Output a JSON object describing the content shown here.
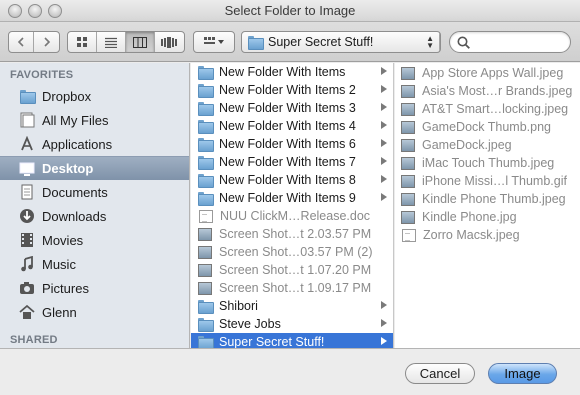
{
  "window": {
    "title": "Select Folder to Image"
  },
  "toolbar": {
    "path_popup": "Super Secret Stuff!",
    "search_placeholder": ""
  },
  "sidebar": {
    "favorites_header": "FAVORITES",
    "shared_header": "SHARED",
    "selected": "Desktop",
    "items": [
      {
        "label": "Dropbox",
        "icon": "folder-icon"
      },
      {
        "label": "All My Files",
        "icon": "all-files-icon"
      },
      {
        "label": "Applications",
        "icon": "applications-icon"
      },
      {
        "label": "Desktop",
        "icon": "desktop-icon"
      },
      {
        "label": "Documents",
        "icon": "documents-icon"
      },
      {
        "label": "Downloads",
        "icon": "downloads-icon"
      },
      {
        "label": "Movies",
        "icon": "movies-icon"
      },
      {
        "label": "Music",
        "icon": "music-icon"
      },
      {
        "label": "Pictures",
        "icon": "pictures-icon"
      },
      {
        "label": "Glenn",
        "icon": "home-icon"
      }
    ]
  },
  "column1": {
    "items": [
      {
        "label": "New Folder With Items",
        "kind": "folder",
        "arrow": true
      },
      {
        "label": "New Folder With Items 2",
        "kind": "folder",
        "arrow": true
      },
      {
        "label": "New Folder With Items 3",
        "kind": "folder",
        "arrow": true
      },
      {
        "label": "New Folder With Items 4",
        "kind": "folder",
        "arrow": true
      },
      {
        "label": "New Folder With Items 6",
        "kind": "folder",
        "arrow": true
      },
      {
        "label": "New Folder With Items 7",
        "kind": "folder",
        "arrow": true
      },
      {
        "label": "New Folder With Items 8",
        "kind": "folder",
        "arrow": true
      },
      {
        "label": "New Folder With Items 9",
        "kind": "folder",
        "arrow": true
      },
      {
        "label": "NUU ClickM…Release.doc",
        "kind": "doc",
        "dim": true
      },
      {
        "label": "Screen Shot…t 2.03.57 PM",
        "kind": "image",
        "dim": true
      },
      {
        "label": "Screen Shot…03.57 PM (2)",
        "kind": "image",
        "dim": true
      },
      {
        "label": "Screen Shot…t 1.07.20 PM",
        "kind": "image",
        "dim": true
      },
      {
        "label": "Screen Shot…t 1.09.17 PM",
        "kind": "image",
        "dim": true
      },
      {
        "label": "Shibori",
        "kind": "folder",
        "arrow": true
      },
      {
        "label": "Steve Jobs",
        "kind": "folder",
        "arrow": true
      },
      {
        "label": "Super Secret Stuff!",
        "kind": "folder",
        "arrow": true,
        "selected": true
      }
    ]
  },
  "column2": {
    "items": [
      {
        "label": "App Store Apps Wall.jpeg",
        "kind": "image"
      },
      {
        "label": "Asia's Most…r Brands.jpeg",
        "kind": "image"
      },
      {
        "label": "AT&T Smart…locking.jpeg",
        "kind": "image"
      },
      {
        "label": "GameDock Thumb.png",
        "kind": "image"
      },
      {
        "label": "GameDock.jpeg",
        "kind": "image"
      },
      {
        "label": "iMac Touch Thumb.jpeg",
        "kind": "image"
      },
      {
        "label": "iPhone Missi…l Thumb.gif",
        "kind": "image"
      },
      {
        "label": "Kindle Phone Thumb.jpeg",
        "kind": "image"
      },
      {
        "label": "Kindle Phone.jpg",
        "kind": "image"
      },
      {
        "label": "Zorro Macsk.jpeg",
        "kind": "image"
      }
    ]
  },
  "buttons": {
    "cancel": "Cancel",
    "confirm": "Image"
  },
  "colors": {
    "selection": "#3875d7",
    "sidebar_bg": "#e2e7ed",
    "primary_button": "#6aa7e9"
  }
}
